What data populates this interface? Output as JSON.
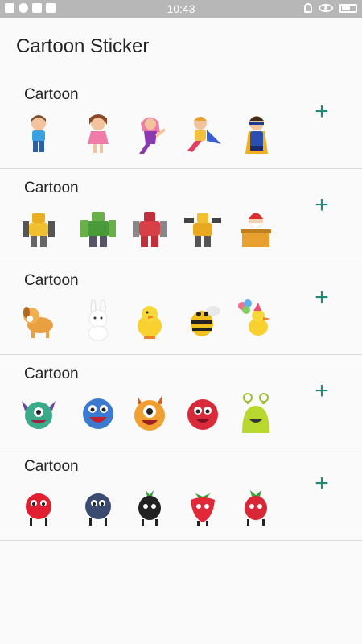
{
  "status_bar": {
    "time": "10:43"
  },
  "app": {
    "title": "Cartoon Sticker"
  },
  "packs": [
    {
      "name": "Cartoon",
      "stickers": [
        "boy",
        "girl",
        "superhero-girl",
        "caped-hero",
        "masked-hero"
      ]
    },
    {
      "name": "Cartoon",
      "stickers": [
        "yellow-robot",
        "green-robot",
        "red-robot",
        "yellow-robot-2",
        "santa-chimney"
      ]
    },
    {
      "name": "Cartoon",
      "stickers": [
        "puppy",
        "bunny",
        "chick",
        "bee",
        "duck-balloons"
      ]
    },
    {
      "name": "Cartoon",
      "stickers": [
        "green-monster",
        "blue-monster",
        "orange-monster",
        "red-monster",
        "green-alien-monster"
      ]
    },
    {
      "name": "Cartoon",
      "stickers": [
        "red-fruit",
        "blueberry",
        "blackberry",
        "strawberry",
        "raspberry"
      ]
    }
  ],
  "add_label": "+",
  "colors": {
    "accent": "#1c8c74",
    "status_bar": "#b7b7b7",
    "background": "#fafafa",
    "divider": "#d9d9d9"
  }
}
